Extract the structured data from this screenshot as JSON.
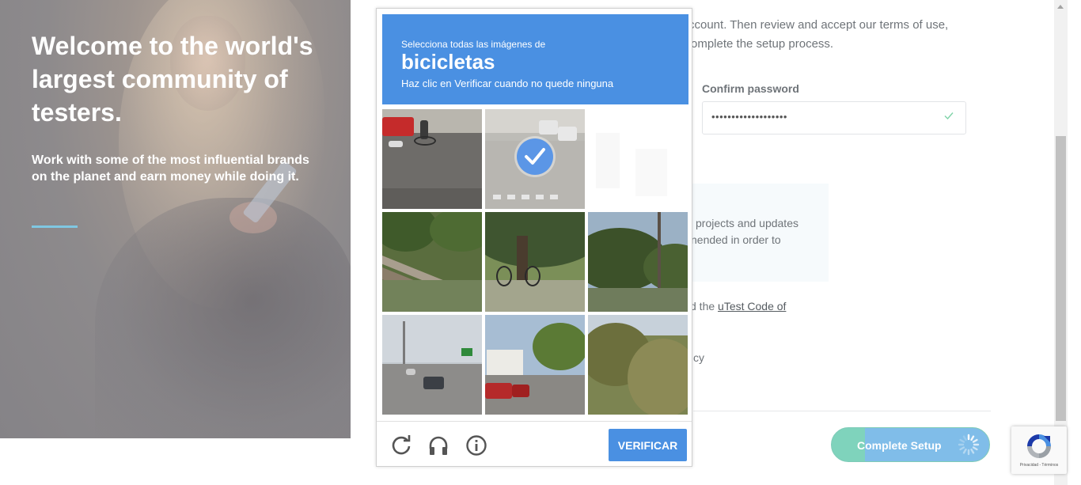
{
  "hero": {
    "title": "Welcome to the world's largest community of testers.",
    "subtitle": "Work with some of the most influential brands on the planet and earn money while doing it."
  },
  "form": {
    "intro_line1": "ccount. Then review and accept our terms of use,",
    "intro_line2": "omplete the setup process.",
    "confirm_label": "Confirm password",
    "confirm_value": "•••••••••••••••••••",
    "info_line1": "projects and updates",
    "info_line2": "nended in order to",
    "code_prefix": "d the ",
    "code_link": "uTest Code of",
    "policy_fragment": "cy",
    "setup_button": "Complete Setup"
  },
  "captcha": {
    "instruction_pre": "Selecciona todas las imágenes de",
    "instruction_target": "bicicletas",
    "instruction_sub": "Haz clic en Verificar cuando no quede ninguna",
    "verify_label": "VERIFICAR",
    "tools": [
      "reload-icon",
      "audio-headphones-icon",
      "info-icon"
    ],
    "tiles": [
      {
        "row": 1,
        "col": 1,
        "scene": "street-cyclist",
        "selected": false
      },
      {
        "row": 1,
        "col": 2,
        "scene": "crosswalk-cars",
        "selected": true
      },
      {
        "row": 1,
        "col": 3,
        "scene": "fading-empty",
        "selected": false
      },
      {
        "row": 2,
        "col": 1,
        "scene": "railing-bushes",
        "selected": false
      },
      {
        "row": 2,
        "col": 2,
        "scene": "tree-cyclist",
        "selected": false
      },
      {
        "row": 2,
        "col": 3,
        "scene": "trees-pole",
        "selected": false
      },
      {
        "row": 3,
        "col": 1,
        "scene": "highway",
        "selected": false
      },
      {
        "row": 3,
        "col": 2,
        "scene": "residential-cars",
        "selected": false
      },
      {
        "row": 3,
        "col": 3,
        "scene": "overgrown-trees",
        "selected": false
      }
    ]
  },
  "badge": {
    "legal": "Privacidad - Términos"
  }
}
